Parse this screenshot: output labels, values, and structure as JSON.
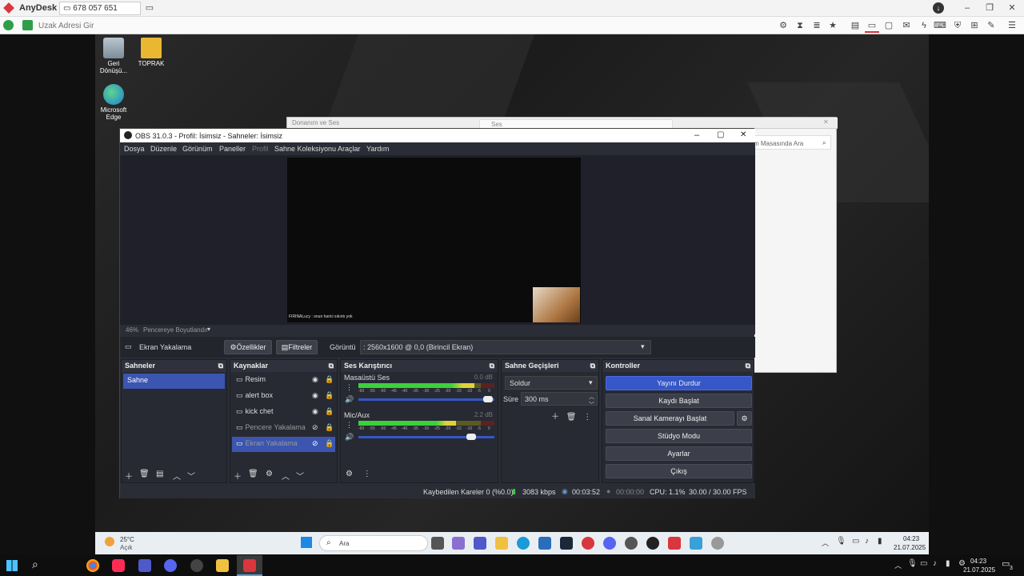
{
  "anydesk": {
    "app_name": "AnyDesk",
    "session_id": "678 057 651",
    "address_placeholder": "Uzak Adresi Gir"
  },
  "desktop": {
    "icons": [
      {
        "label": "Geri Dönüşü...",
        "icon": "recycle-bin-icon"
      },
      {
        "label": "TOPRAK",
        "icon": "folder-icon"
      },
      {
        "label": "Microsoft Edge",
        "icon": "edge-icon"
      }
    ]
  },
  "bg_window": {
    "title": "Donanım ve Ses",
    "tab": "Ses",
    "search_placeholder": "m Masasında Ara"
  },
  "obs": {
    "title": "OBS 31.0.3 - Profil: İsimsiz - Sahneler: İsimsiz",
    "menu": [
      "Dosya",
      "Düzenle",
      "Görünüm",
      "Paneller",
      "Profil",
      "Sahne Koleksiyonu",
      "Araçlar",
      "Yardım"
    ],
    "chat_text": "FIRINALucy : onun harici sıkıntı yok",
    "zoom": "46%",
    "zoom_mode": "Pencereye Boyutlandır",
    "source_label": "Ekran Yakalama",
    "properties_btn": "Özellikler",
    "filters_btn": "Filtreler",
    "display_label": "Görüntü",
    "display_value": ": 2560x1600 @ 0,0 (Birincil Ekran)",
    "scenes": {
      "title": "Sahneler",
      "items": [
        "Sahne"
      ]
    },
    "sources": {
      "title": "Kaynaklar",
      "items": [
        {
          "name": "Resim",
          "dim": false
        },
        {
          "name": "alert box",
          "dim": false
        },
        {
          "name": "kick chet",
          "dim": false
        },
        {
          "name": "Pencere Yakalama",
          "dim": true
        },
        {
          "name": "Ekran Yakalama",
          "dim": true
        }
      ]
    },
    "mixer": {
      "title": "Ses Karıştırıcı",
      "channels": [
        {
          "name": "Masaüstü Ses",
          "db": "0.0 dB",
          "level": 0.85,
          "volume": 0.95
        },
        {
          "name": "Mic/Aux",
          "db": "2.2 dB",
          "level": 0.72,
          "volume": 0.83
        }
      ],
      "scale": [
        "-60",
        "-55",
        "-50",
        "-45",
        "-40",
        "-35",
        "-30",
        "-25",
        "-20",
        "-15",
        "-10",
        "-5",
        "0"
      ]
    },
    "transitions": {
      "title": "Sahne Geçişleri",
      "type": "Soldur",
      "duration_label": "Süre",
      "duration": "300 ms"
    },
    "controls": {
      "title": "Kontroller",
      "buttons": [
        "Yayını Durdur",
        "Kaydı Başlat",
        "Sanal Kamerayı Başlat",
        "Stüdyo Modu",
        "Ayarlar",
        "Çıkış"
      ]
    },
    "status": {
      "dropped": "Kaybedilen Kareler 0 (%0.0)",
      "bitrate": "3083 kbps",
      "stream_time": "00:03:52",
      "rec_time": "00:00:00",
      "cpu": "CPU: 1.1%",
      "fps": "30.00 / 30.00 FPS"
    }
  },
  "remote_taskbar": {
    "weather_temp": "25°C",
    "weather_desc": "Açık",
    "search_placeholder": "Ara",
    "time": "04:23",
    "date": "21.07.2025"
  },
  "local_taskbar": {
    "time": "04:23",
    "date": "21.07.2025",
    "notif_count": "3"
  },
  "colors": {
    "accent": "#3557c8",
    "obs_bg": "#2b2d36",
    "anydesk_red": "#d9363e"
  }
}
